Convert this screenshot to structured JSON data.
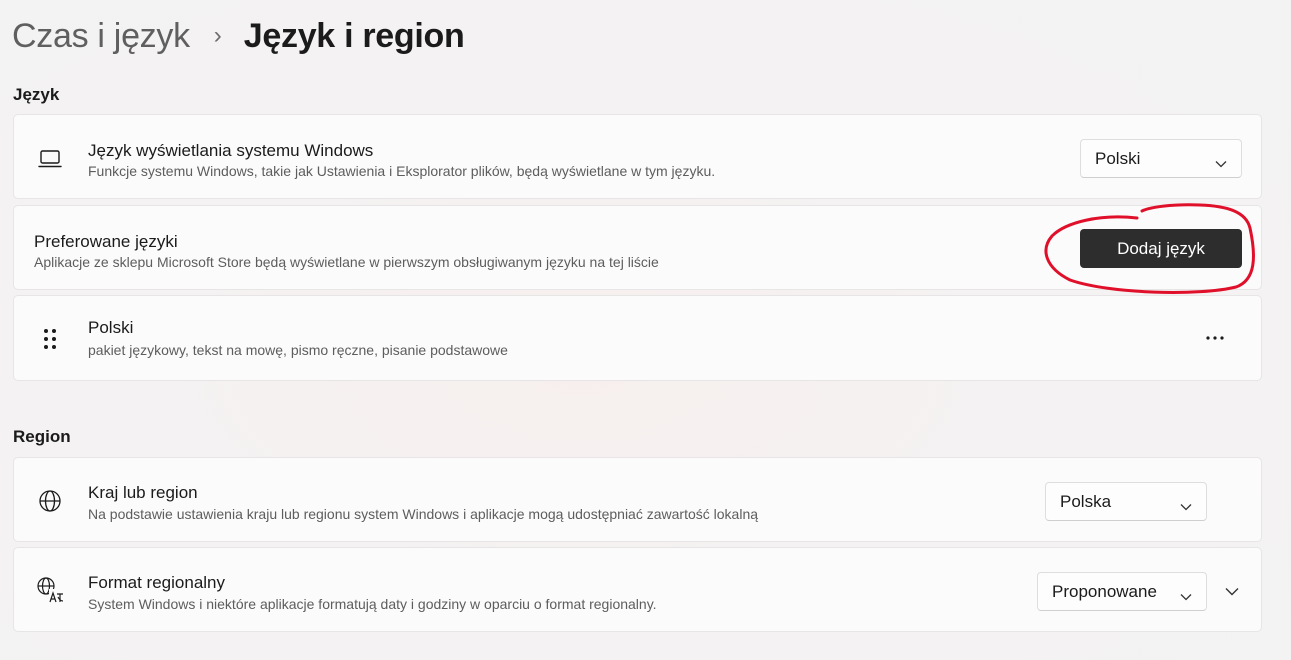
{
  "breadcrumb": {
    "parent": "Czas i język",
    "separator": "›",
    "current": "Język i region"
  },
  "language_section": {
    "title": "Język",
    "display_language": {
      "icon": "laptop-icon",
      "title": "Język wyświetlania systemu Windows",
      "description": "Funkcje systemu Windows, takie jak Ustawienia i Eksplorator plików, będą wyświetlane w tym języku.",
      "dropdown_value": "Polski"
    },
    "preferred_languages": {
      "title": "Preferowane języki",
      "description": "Aplikacje ze sklepu Microsoft Store będą wyświetlane w pierwszym obsługiwanym języku na tej liście",
      "button_label": "Dodaj język"
    },
    "languages": [
      {
        "icon": "drag-handle-icon",
        "name": "Polski",
        "features": "pakiet językowy, tekst na mowę, pismo ręczne, pisanie podstawowe",
        "more_icon": "more-options-icon"
      }
    ]
  },
  "region_section": {
    "title": "Region",
    "country": {
      "icon": "globe-icon",
      "title": "Kraj lub region",
      "description": "Na podstawie ustawienia kraju lub regionu system Windows i aplikacje mogą udostępniać zawartość lokalną",
      "dropdown_value": "Polska"
    },
    "regional_format": {
      "icon": "language-format-icon",
      "title": "Format regionalny",
      "description": "System Windows i niektóre aplikacje formatują daty i godziny w oparciu o format regionalny.",
      "dropdown_value": "Proponowane",
      "expand_icon": "chevron-down-icon"
    }
  },
  "colors": {
    "accent_button": "#2d2d2d",
    "annotation": "#e0102a",
    "background": "#f3f2f2",
    "card": "#fbfbfb"
  }
}
